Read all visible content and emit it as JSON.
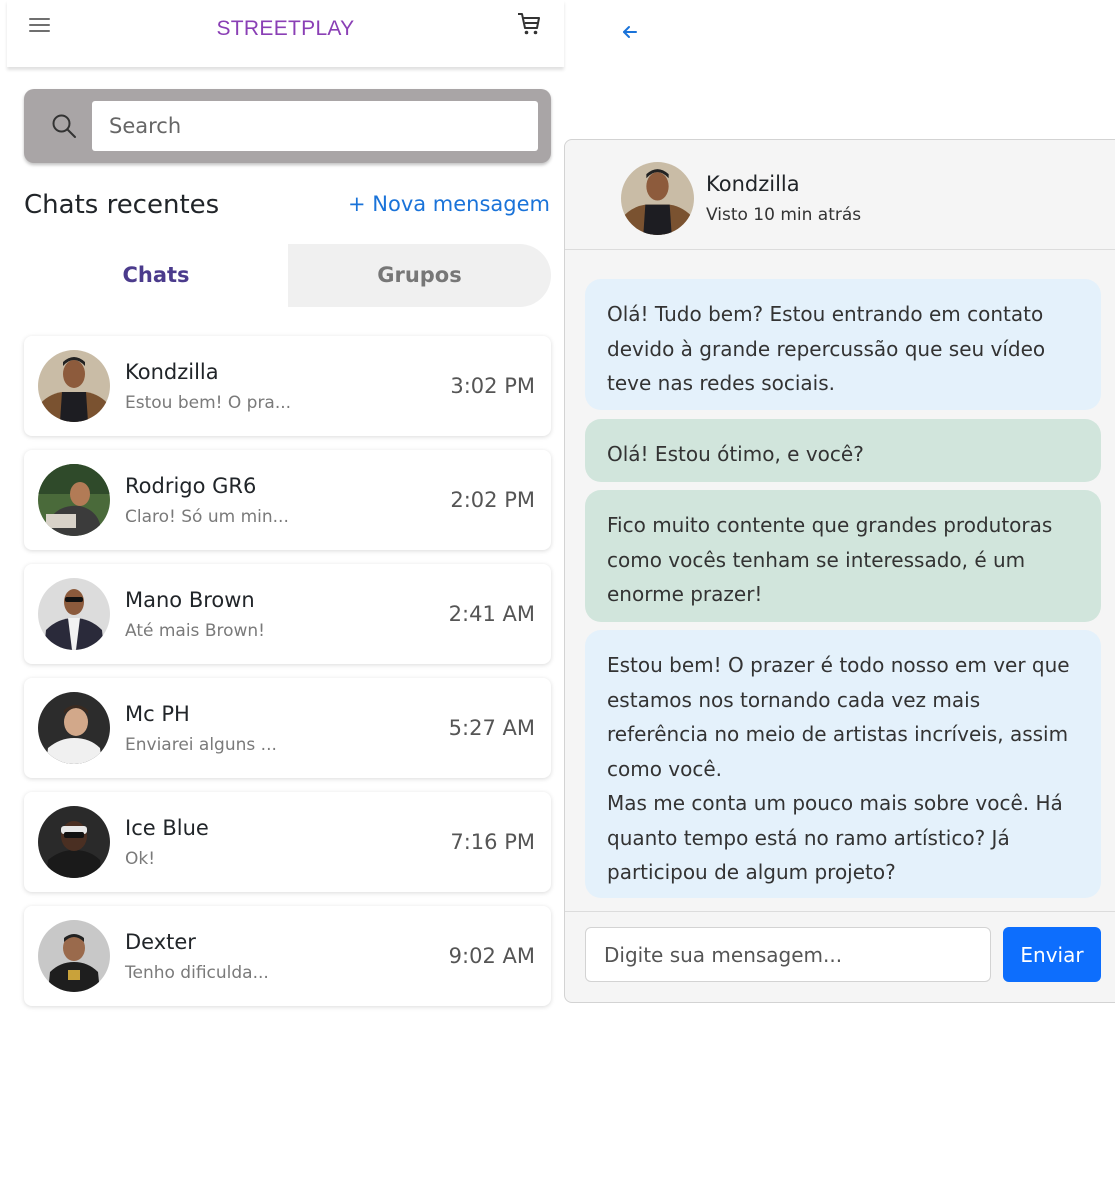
{
  "topbar": {
    "brand": "STREETPLAY",
    "menu_icon": "hamburger-menu-icon",
    "cart_icon": "shopping-cart-icon"
  },
  "search": {
    "placeholder": "Search",
    "value": "",
    "icon": "search-icon"
  },
  "recent": {
    "title": "Chats recentes",
    "new_message": "+ Nova mensagem"
  },
  "tabs": [
    {
      "label": "Chats",
      "active": true
    },
    {
      "label": "Grupos",
      "active": false
    }
  ],
  "chats": [
    {
      "name": "Kondzilla",
      "preview": "Estou bem! O pra...",
      "time": "3:02 PM"
    },
    {
      "name": "Rodrigo GR6",
      "preview": "Claro! Só um min...",
      "time": "2:02 PM"
    },
    {
      "name": "Mano Brown",
      "preview": "Até mais Brown!",
      "time": "2:41 AM"
    },
    {
      "name": "Mc PH",
      "preview": "Enviarei alguns ...",
      "time": "5:27 AM"
    },
    {
      "name": "Ice Blue",
      "preview": "Ok!",
      "time": "7:16 PM"
    },
    {
      "name": "Dexter",
      "preview": "Tenho dificulda...",
      "time": "9:02 AM"
    }
  ],
  "conversation": {
    "back_icon": "arrow-left-icon",
    "contact_name": "Kondzilla",
    "contact_status": "Visto 10 min atrás",
    "messages": [
      {
        "type": "received",
        "text": "Olá! Tudo bem? Estou entrando em contato devido à grande repercussão que seu vídeo teve nas redes sociais."
      },
      {
        "type": "sent",
        "text": "Olá! Estou ótimo, e você?"
      },
      {
        "type": "sent",
        "text": "Fico muito contente que grandes produtoras como vocês tenham se interessado, é um enorme prazer!"
      },
      {
        "type": "received",
        "text": "Estou bem! O prazer é todo nosso em ver que estamos nos tornando cada vez mais referência no meio de artistas incríveis, assim como você.\nMas me conta um pouco mais sobre você. Há quanto tempo está no ramo artístico? Já participou de algum projeto?"
      }
    ],
    "input_placeholder": "Digite sua mensagem...",
    "send_label": "Enviar"
  },
  "colors": {
    "brand": "#8a3fb5",
    "link": "#1a73d9",
    "active_tab": "#4b3b8c",
    "send_button": "#0d6efd",
    "received_bubble": "#e4f1fb",
    "sent_bubble": "#d1e5dc"
  }
}
